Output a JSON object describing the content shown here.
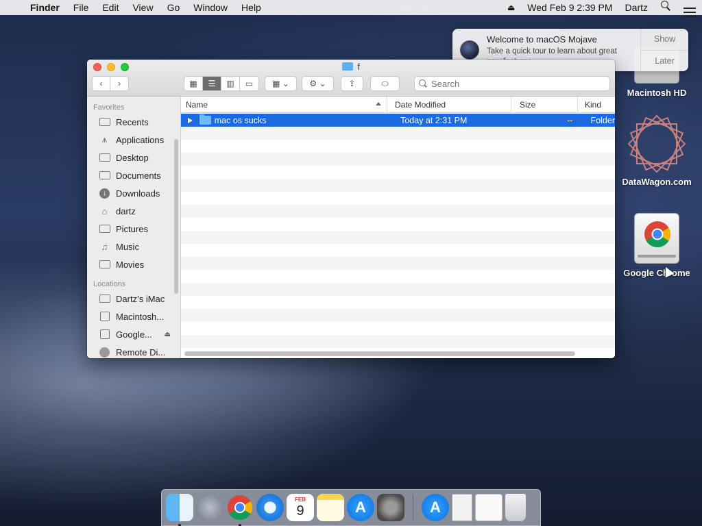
{
  "menubar": {
    "app": "Finder",
    "items": [
      "File",
      "Edit",
      "View",
      "Go",
      "Window",
      "Help"
    ],
    "datetime": "Wed Feb 9  2:39 PM",
    "user": "Dartz"
  },
  "notification": {
    "title": "Welcome to macOS Mojave",
    "text": "Take a quick tour to learn about great new features.",
    "show": "Show",
    "later": "Later"
  },
  "desktop": {
    "icons": [
      "Macintosh HD",
      "DataWagon.com",
      "Google Chrome"
    ]
  },
  "window": {
    "title": "f",
    "search_placeholder": "Search",
    "sidebar": {
      "favorites_header": "Favorites",
      "favorites": [
        {
          "label": "Recents",
          "icon": "recents-icon"
        },
        {
          "label": "Applications",
          "icon": "applications-icon"
        },
        {
          "label": "Desktop",
          "icon": "desktop-icon"
        },
        {
          "label": "Documents",
          "icon": "documents-icon"
        },
        {
          "label": "Downloads",
          "icon": "downloads-icon"
        },
        {
          "label": "dartz",
          "icon": "home-icon"
        },
        {
          "label": "Pictures",
          "icon": "camera-icon"
        },
        {
          "label": "Music",
          "icon": "music-note-icon"
        },
        {
          "label": "Movies",
          "icon": "film-icon"
        }
      ],
      "locations_header": "Locations",
      "locations": [
        {
          "label": "Dartz’s iMac",
          "icon": "computer-icon"
        },
        {
          "label": "Macintosh...",
          "icon": "hard-disk-icon"
        },
        {
          "label": "Google...",
          "icon": "external-disk-icon"
        },
        {
          "label": "Remote Di...",
          "icon": "optical-disc-icon"
        }
      ]
    },
    "columns": {
      "name": "Name",
      "date": "Date Modified",
      "size": "Size",
      "kind": "Kind"
    },
    "rows": [
      {
        "name": "mac os sucks",
        "date": "Today at 2:31 PM",
        "size": "--",
        "kind": "Folder",
        "selected": true
      }
    ]
  },
  "dock": {
    "calendar_month": "FEB",
    "calendar_day": "9"
  },
  "colors": {
    "selection": "#1b6ae0",
    "folder": "#6cbcf6",
    "close": "#fc5f57",
    "minimize": "#fdbc2e",
    "maximize": "#28c840"
  }
}
